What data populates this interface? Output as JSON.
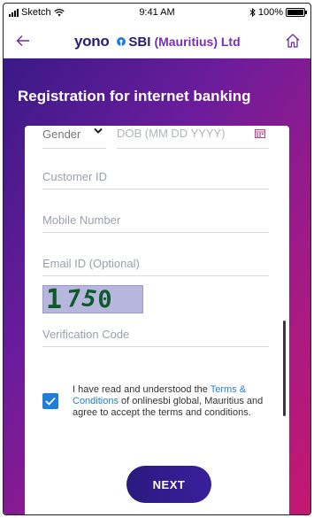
{
  "status_bar": {
    "carrier": "Sketch",
    "time": "9:41 AM",
    "battery": "100%",
    "battery_level": 1.0
  },
  "header": {
    "brand_yono": "yono",
    "brand_sbi": "SBI",
    "brand_sub": "(Mauritius) Ltd",
    "icons": {
      "back": "arrow-left-icon",
      "home": "home-icon"
    }
  },
  "page": {
    "title": "Registration for internet banking"
  },
  "form": {
    "gender_label": "Gender",
    "dob_placeholder": "DOB (MM DD YYYY)",
    "customer_id_placeholder": "Customer ID",
    "mobile_placeholder": "Mobile Number",
    "email_placeholder": "Email ID (Optional)",
    "captcha_chars": [
      "1",
      "7",
      "5",
      "0"
    ],
    "verification_placeholder": "Verification Code",
    "terms": {
      "checked": true,
      "prefix": "I have read and understood the ",
      "link": "Terms & Conditions",
      "suffix": " of onlinesbi global, Mauritius and agree to accept the terms and conditions."
    },
    "next_label": "NEXT"
  },
  "colors": {
    "brand": "#2a1d6e",
    "accent": "#7a2fb3",
    "link": "#1f7fd6",
    "gradient_start": "#3a1a86",
    "gradient_end": "#c41870"
  }
}
